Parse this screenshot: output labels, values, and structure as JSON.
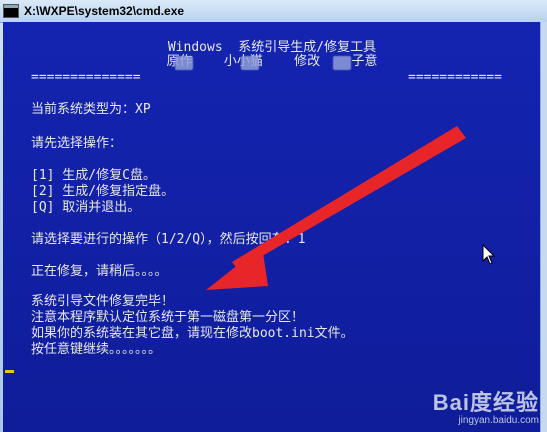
{
  "window": {
    "title": "X:\\WXPE\\system32\\cmd.exe",
    "icon": "cmd-icon"
  },
  "console": {
    "heading": "Windows  系统引导生成/修复工具",
    "subheading": "原作    小小猫    修改    子意",
    "rule_left": "==============",
    "rule_right": "============",
    "line_sys_type": "当前系统类型为：XP",
    "line_choose": "请先选择操作：",
    "option_1": "[1] 生成/修复C盘。",
    "option_2": "[2] 生成/修复指定盘。",
    "option_q": "[Q] 取消并退出。",
    "prompt": "请选择要进行的操作（1/2/Q），然后按回车：1",
    "repairing": "正在修复，请稍后。。。。",
    "done": "系统引导文件修复完毕！",
    "note_1": "注意本程序默认定位系统于第一磁盘第一分区！",
    "note_2": "如果你的系统装在其它盘，请现在修改boot.ini文件。",
    "press_key": "按任意键继续。。。。。。。"
  },
  "watermark": {
    "brand": "Bai度经验",
    "site": "jingyan.baidu.com"
  },
  "colors": {
    "console_bg": "#1220a6",
    "console_text": "#e8e8e8",
    "arrow": "#e8262a",
    "cursor": "#d8d000"
  }
}
